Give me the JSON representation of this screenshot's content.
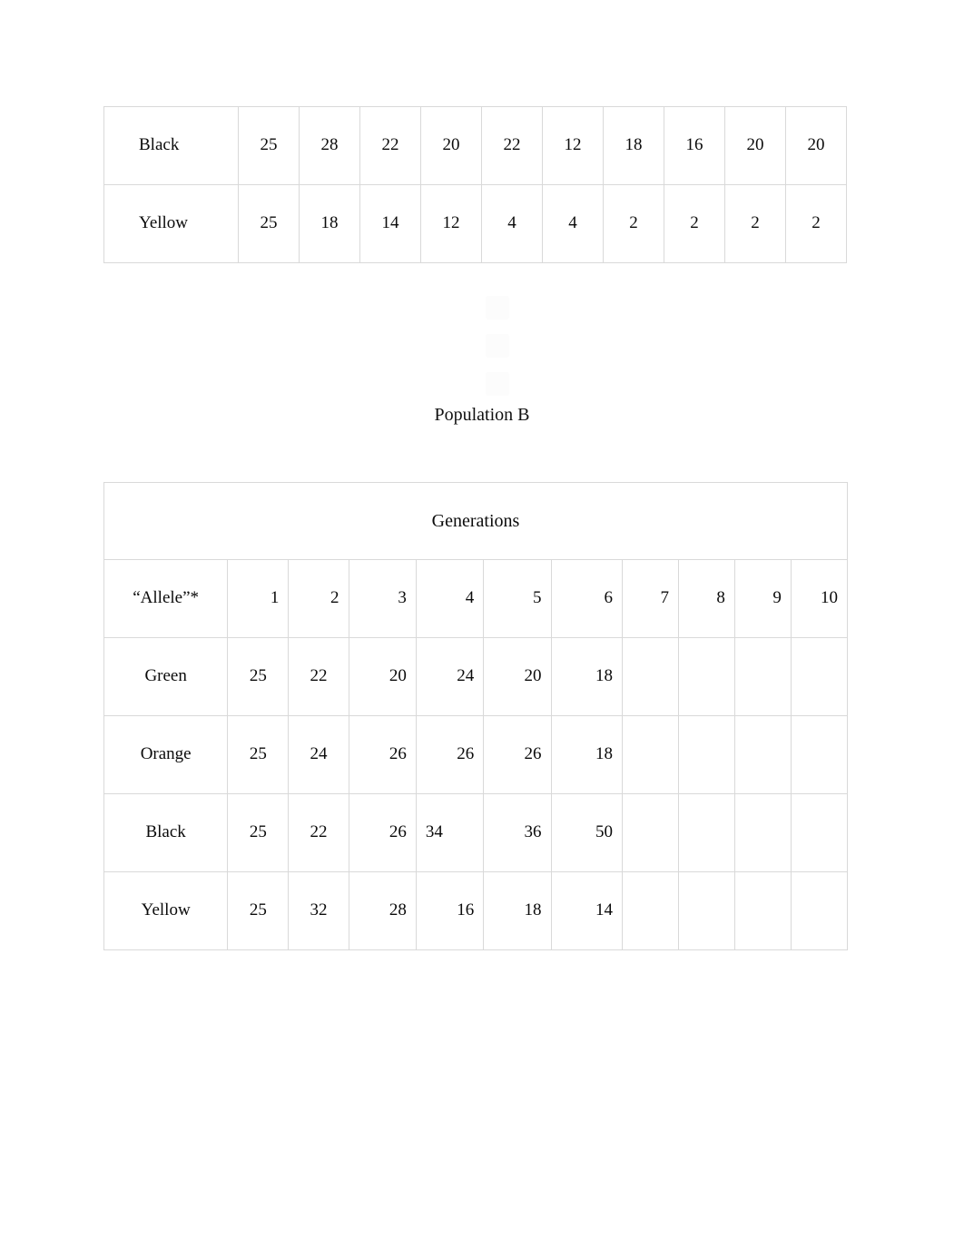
{
  "page": {
    "background": "#ffffff",
    "border_color": "#d9d9d9",
    "text_color": "#0b0b0b"
  },
  "caption": {
    "population_b": "Population B"
  },
  "table_pop_a_continued": {
    "rows": [
      {
        "label": "Black",
        "values": [
          "25",
          "28",
          "22",
          "20",
          "22",
          "12",
          "18",
          "16",
          "20",
          "20"
        ]
      },
      {
        "label": "Yellow",
        "values": [
          "25",
          "18",
          "14",
          "12",
          "4",
          "4",
          "2",
          "2",
          "2",
          "2"
        ]
      }
    ]
  },
  "table_pop_b": {
    "header_span_label": "Generations",
    "corner_label": "“Allele”*",
    "generation_columns": [
      "1",
      "2",
      "3",
      "4",
      "5",
      "6",
      "7",
      "8",
      "9",
      "10"
    ],
    "rows": [
      {
        "label": "Green",
        "values": [
          "25",
          "22",
          "20",
          "24",
          "20",
          "18",
          "",
          "",
          "",
          ""
        ]
      },
      {
        "label": "Orange",
        "values": [
          "25",
          "24",
          "26",
          "26",
          "26",
          "18",
          "",
          "",
          "",
          ""
        ]
      },
      {
        "label": "Black",
        "values": [
          "25",
          "22",
          "26",
          "34",
          "36",
          "50",
          "",
          "",
          "",
          ""
        ]
      },
      {
        "label": "Yellow",
        "values": [
          "25",
          "32",
          "28",
          "16",
          "18",
          "14",
          "",
          "",
          "",
          ""
        ]
      }
    ]
  },
  "chart_data": {
    "type": "table",
    "title": "Population B",
    "xlabel": "Generations",
    "ylabel": "“Allele”*",
    "categories": [
      "1",
      "2",
      "3",
      "4",
      "5",
      "6",
      "7",
      "8",
      "9",
      "10"
    ],
    "series": [
      {
        "name": "Green",
        "values": [
          25,
          22,
          20,
          24,
          20,
          18,
          null,
          null,
          null,
          null
        ]
      },
      {
        "name": "Orange",
        "values": [
          25,
          24,
          26,
          26,
          26,
          18,
          null,
          null,
          null,
          null
        ]
      },
      {
        "name": "Black",
        "values": [
          25,
          22,
          26,
          34,
          36,
          50,
          null,
          null,
          null,
          null
        ]
      },
      {
        "name": "Yellow",
        "values": [
          25,
          32,
          28,
          16,
          18,
          14,
          null,
          null,
          null,
          null
        ]
      }
    ],
    "additional_series_population_a": [
      {
        "name": "Black",
        "values": [
          25,
          28,
          22,
          20,
          22,
          12,
          18,
          16,
          20,
          20
        ]
      },
      {
        "name": "Yellow",
        "values": [
          25,
          18,
          14,
          12,
          4,
          4,
          2,
          2,
          2,
          2
        ]
      }
    ]
  }
}
